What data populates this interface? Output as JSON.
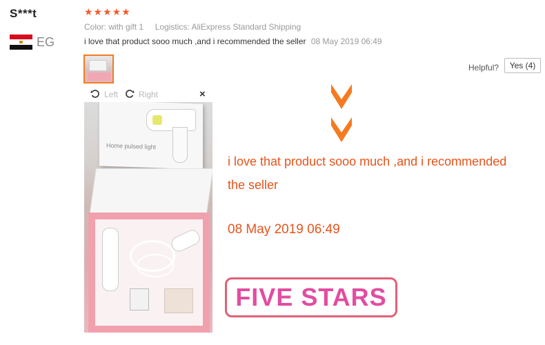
{
  "user": {
    "name": "S***t",
    "country": "EG"
  },
  "review": {
    "stars": "★★★★★",
    "color_label": "Color:",
    "color_value": "with gift 1",
    "logistics_label": "Logistics:",
    "logistics_value": "AliExpress Standard Shipping",
    "text": "i love that product sooo much ,and i recommended the seller",
    "date": "08 May 2019 06:49"
  },
  "helpful": {
    "label": "Helpful?",
    "yes_button": "Yes (4)"
  },
  "viewer": {
    "left_label": "Left",
    "right_label": "Right",
    "close": "×",
    "box_label": "Home pulsed light"
  },
  "annotation": {
    "line1": "i love that product sooo much ,and i recommended",
    "line2": "the seller",
    "date": "08 May 2019 06:49",
    "stamp": "FIVE  STARS"
  },
  "colors": {
    "accent": "#f47b20",
    "annotation": "#e8531a",
    "stamp_border": "#e06076",
    "stamp_text": "#e24da0"
  }
}
